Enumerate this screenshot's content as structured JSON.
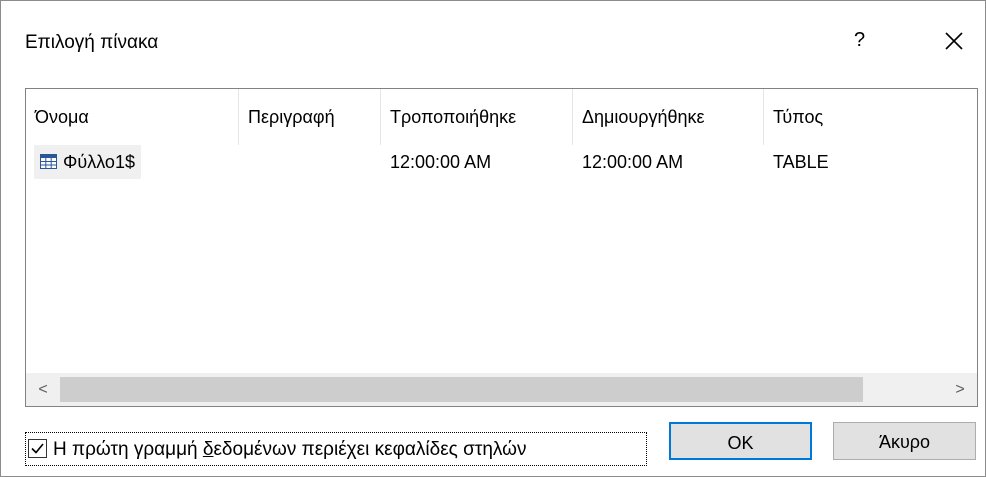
{
  "window": {
    "title": "Επιλογή πίνακα",
    "help_label": "?"
  },
  "columns": [
    "Όνομα",
    "Περιγραφή",
    "Τροποποιήθηκε",
    "Δημιουργήθηκε",
    "Τύπος"
  ],
  "rows": [
    {
      "name": "Φύλλο1$",
      "description": "",
      "modified": "12:00:00 AM",
      "created": "12:00:00 AM",
      "type": "TABLE"
    }
  ],
  "scrollbar": {
    "left_arrow": "<",
    "right_arrow": ">"
  },
  "first_row_headers": {
    "label_before": "Η πρώτη γραμμή ",
    "label_underlined": "δ",
    "label_after": "εδομένων περιέχει κεφαλίδες στηλών",
    "checked": true
  },
  "buttons": {
    "ok": "OK",
    "cancel": "Άκυρο"
  },
  "colors": {
    "accent": "#0078d7",
    "icon_blue": "#2b579a"
  }
}
